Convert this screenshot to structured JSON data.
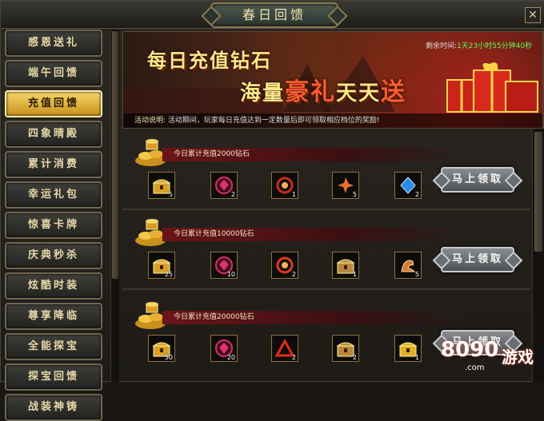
{
  "window": {
    "title": "春日回馈",
    "close_label": "✕"
  },
  "sidebar": {
    "items": [
      {
        "label": "感恩送礼",
        "active": false
      },
      {
        "label": "端午回馈",
        "active": false
      },
      {
        "label": "充值回馈",
        "active": true
      },
      {
        "label": "四象晴殿",
        "active": false
      },
      {
        "label": "累计消费",
        "active": false
      },
      {
        "label": "幸运礼包",
        "active": false
      },
      {
        "label": "惊喜卡牌",
        "active": false
      },
      {
        "label": "庆典秒杀",
        "active": false
      },
      {
        "label": "炫酷时装",
        "active": false
      },
      {
        "label": "尊享降临",
        "active": false
      },
      {
        "label": "全能探宝",
        "active": false
      },
      {
        "label": "探宝回馈",
        "active": false
      },
      {
        "label": "战装神铸",
        "active": false
      }
    ]
  },
  "banner": {
    "line1": "每日充值钻石",
    "line2_a": "海量",
    "line2_b": "豪礼",
    "line2_c": "天天",
    "line2_d": "送",
    "countdown_label": "剩余时间:",
    "countdown_value": "1天23小时55分钟40秒",
    "desc_label": "活动说明:",
    "desc_text": "活动期间，玩家每日充值达到一定数量后即可领取相应档位的奖励!"
  },
  "rewards": [
    {
      "title": "今日累计充值2000钻石",
      "claim_label": "马上领取",
      "items": [
        {
          "icon": "treasure-chest-icon",
          "qty": "5",
          "color": "#d8a02a"
        },
        {
          "icon": "red-gem-box-icon",
          "qty": "2",
          "color": "#e0306a"
        },
        {
          "icon": "red-orb-icon",
          "qty": "1",
          "color": "#d02a1a"
        },
        {
          "icon": "fire-crystal-icon",
          "qty": "5",
          "color": "#e8702a"
        },
        {
          "icon": "blue-gem-icon",
          "qty": "2",
          "color": "#2a8ae8"
        }
      ]
    },
    {
      "title": "今日累计充值10000钻石",
      "claim_label": "马上领取",
      "items": [
        {
          "icon": "treasure-chest-icon",
          "qty": "25",
          "color": "#d8a02a"
        },
        {
          "icon": "red-gem-box-icon",
          "qty": "10",
          "color": "#e0306a"
        },
        {
          "icon": "red-ring-icon",
          "qty": "2",
          "color": "#e03a1a"
        },
        {
          "icon": "ornate-chest-icon",
          "qty": "1",
          "color": "#b8883a"
        },
        {
          "icon": "dragon-figure-icon",
          "qty": "5",
          "color": "#d87a2a"
        }
      ]
    },
    {
      "title": "今日累计充值20000钻石",
      "claim_label": "马上领取",
      "items": [
        {
          "icon": "treasure-chest-icon",
          "qty": "50",
          "color": "#d8a02a"
        },
        {
          "icon": "red-gem-box-icon",
          "qty": "20",
          "color": "#e0306a"
        },
        {
          "icon": "red-triangle-icon",
          "qty": "2",
          "color": "#e02a1a"
        },
        {
          "icon": "ornate-chest-icon",
          "qty": "2",
          "color": "#b8883a"
        },
        {
          "icon": "gold-chest-icon",
          "qty": "1",
          "color": "#e0b02a"
        }
      ]
    }
  ],
  "watermark": {
    "number": "8090",
    "cn": "游戏",
    "domain": ".com"
  }
}
